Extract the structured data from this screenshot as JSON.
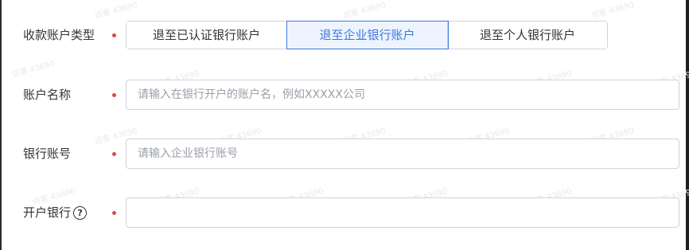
{
  "form": {
    "account_type": {
      "label": "收款账户类型",
      "options": [
        "退至已认证银行账户",
        "退至企业银行账户",
        "退至个人银行账户"
      ],
      "selected_index": 1
    },
    "account_name": {
      "label": "账户名称",
      "placeholder": "请输入在银行开户的账户名，例如XXXXX公司",
      "value": ""
    },
    "account_number": {
      "label": "银行账号",
      "placeholder": "请输入企业银行账号",
      "value": ""
    },
    "bank": {
      "label": "开户银行",
      "help_icon": "question-circle-icon",
      "help_glyph": "?",
      "value": ""
    }
  },
  "watermark": {
    "text": "访客 43690"
  },
  "colors": {
    "required_dot": "#e0483d",
    "active": "#3b78e0",
    "active_bg": "#eef4ff",
    "border": "#d0d3d8",
    "placeholder": "#9aa0a8"
  }
}
